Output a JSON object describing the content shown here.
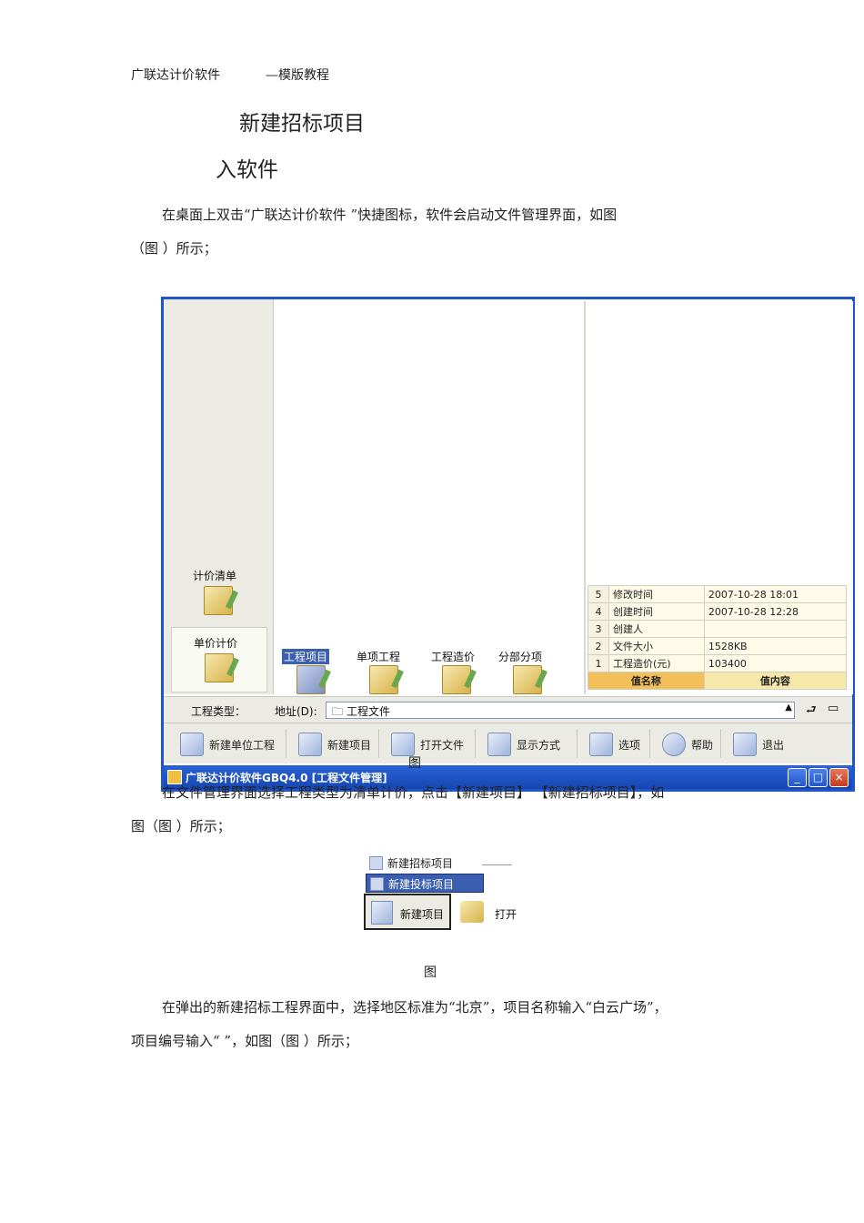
{
  "header": {
    "left": "广联达计价软件",
    "right": "—模版教程"
  },
  "headings": {
    "h1": "新建招标项目",
    "h2": "入软件"
  },
  "paragraphs": {
    "p1_line1": "在桌面上双击“广联达计价软件            ”快捷图标，软件会启动文件管理界面，如图",
    "p1_line2": "（图        ）所示；",
    "p2_line1": "在文件管理界面选择工程类型为清单计价，点击【新建项目】    【新建招标项目】，如",
    "p2_line2": "图（图        ）所示；",
    "p3_line1": "在弹出的新建招标工程界面中，选择地区标准为“北京”，项目名称输入“白云广场”，",
    "p3_line2": "项目编号输入“                    ”，如图（图        ）所示；"
  },
  "figure1": {
    "caption": "图",
    "sidebar": {
      "item1": "计价清单",
      "item2": "单价计价"
    },
    "file_types": [
      "工程项目",
      "单项工程",
      "工程造价",
      "分部分项"
    ],
    "info_header": [
      "值名称",
      "值内容"
    ],
    "info_rows": [
      {
        "n": "1",
        "label": "工程造价(元)",
        "value": "103400"
      },
      {
        "n": "2",
        "label": "文件大小",
        "value": "1528KB"
      },
      {
        "n": "3",
        "label": "创建人",
        "value": ""
      },
      {
        "n": "4",
        "label": "创建时间",
        "value": "2007-10-28 12:28"
      },
      {
        "n": "5",
        "label": "修改时间",
        "value": "2007-10-28 18:01"
      }
    ],
    "path": {
      "label": "工程类型：",
      "addr": "地址(D):",
      "value": "工程文件"
    },
    "toolbar": [
      "新建单位工程",
      "新建项目",
      "打开文件",
      "显示方式",
      "选项",
      "帮助",
      "退出"
    ],
    "window_title": "广联达计价软件GBQ4.0 [工程文件管理]",
    "window_buttons": [
      "_",
      "□",
      "×"
    ]
  },
  "figure2": {
    "caption": "图",
    "menu_items": [
      "新建招标项目",
      "新建投标项目"
    ],
    "button": "新建项目",
    "cut_label": "打开"
  }
}
